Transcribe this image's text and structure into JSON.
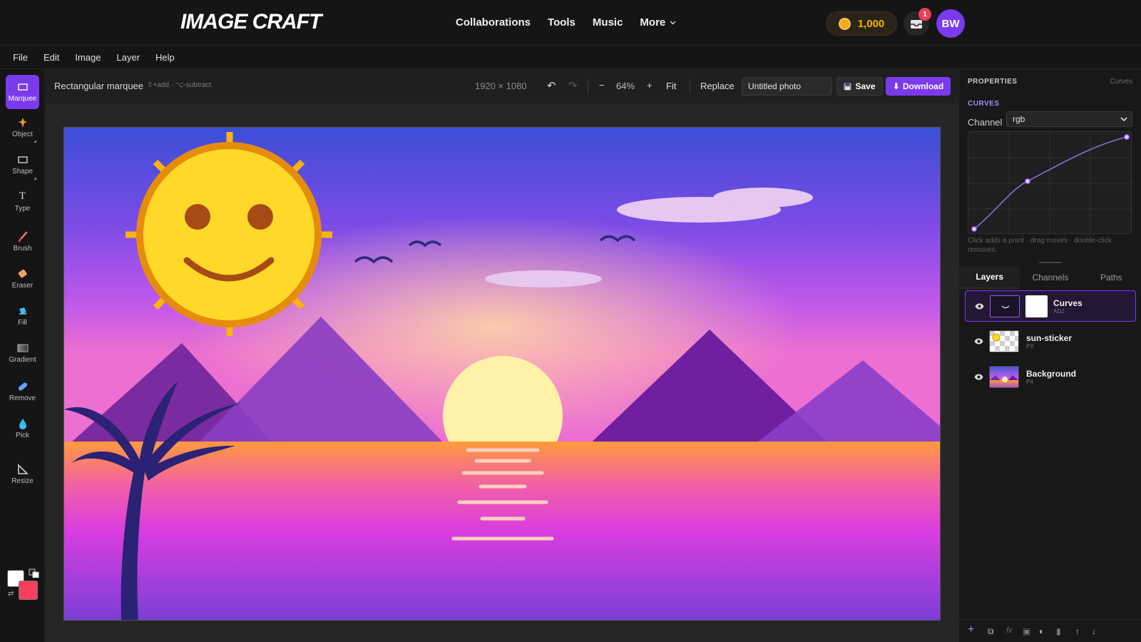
{
  "app": {
    "logo": "IMAGE CRAFT",
    "nav": [
      "Collaborations",
      "Tools",
      "Music",
      "More"
    ],
    "coins": "1,000",
    "notif_count": "1",
    "avatar_initials": "BW",
    "accent_color": "#7c3aed"
  },
  "menu": [
    "File",
    "Edit",
    "Image",
    "Layer",
    "Help"
  ],
  "tools": [
    {
      "label": "Marquee",
      "icon": "marquee-icon",
      "active": true
    },
    {
      "label": "Object",
      "icon": "sparkle-icon"
    },
    {
      "label": "Shape",
      "icon": "rectangle-icon"
    },
    {
      "label": "Type",
      "icon": "type-icon"
    },
    {
      "label": "Brush",
      "icon": "brush-icon"
    },
    {
      "label": "Eraser",
      "icon": "eraser-icon"
    },
    {
      "label": "Fill",
      "icon": "fill-icon"
    },
    {
      "label": "Gradient",
      "icon": "gradient-icon"
    },
    {
      "label": "Remove",
      "icon": "bandage-icon"
    },
    {
      "label": "Pick",
      "icon": "droplet-icon"
    },
    {
      "label": "Resize",
      "icon": "resize-icon"
    }
  ],
  "colors": {
    "foreground": "#ffffff",
    "background": "#f43f5e"
  },
  "toolbar": {
    "tool_name": "Rectangular marquee",
    "hint": "⇧+add · ⌥-subtract",
    "dimensions": "1920 × 1080",
    "zoom": "64%",
    "fit": "Fit",
    "replace": "Replace",
    "filename": "Untitled photo",
    "save": "Save",
    "download": "Download"
  },
  "properties": {
    "title": "PROPERTIES",
    "subtitle": "Curves",
    "section": "CURVES",
    "channel_label": "Channel",
    "channel_value": "rgb",
    "help": "Click adds a point · drag moves · double-click removes."
  },
  "panel_tabs": [
    "Layers",
    "Channels",
    "Paths"
  ],
  "layers": [
    {
      "name": "Curves",
      "type": "ADJ",
      "selected": true
    },
    {
      "name": "sun-sticker",
      "type": "PX"
    },
    {
      "name": "Background",
      "type": "PX"
    }
  ]
}
